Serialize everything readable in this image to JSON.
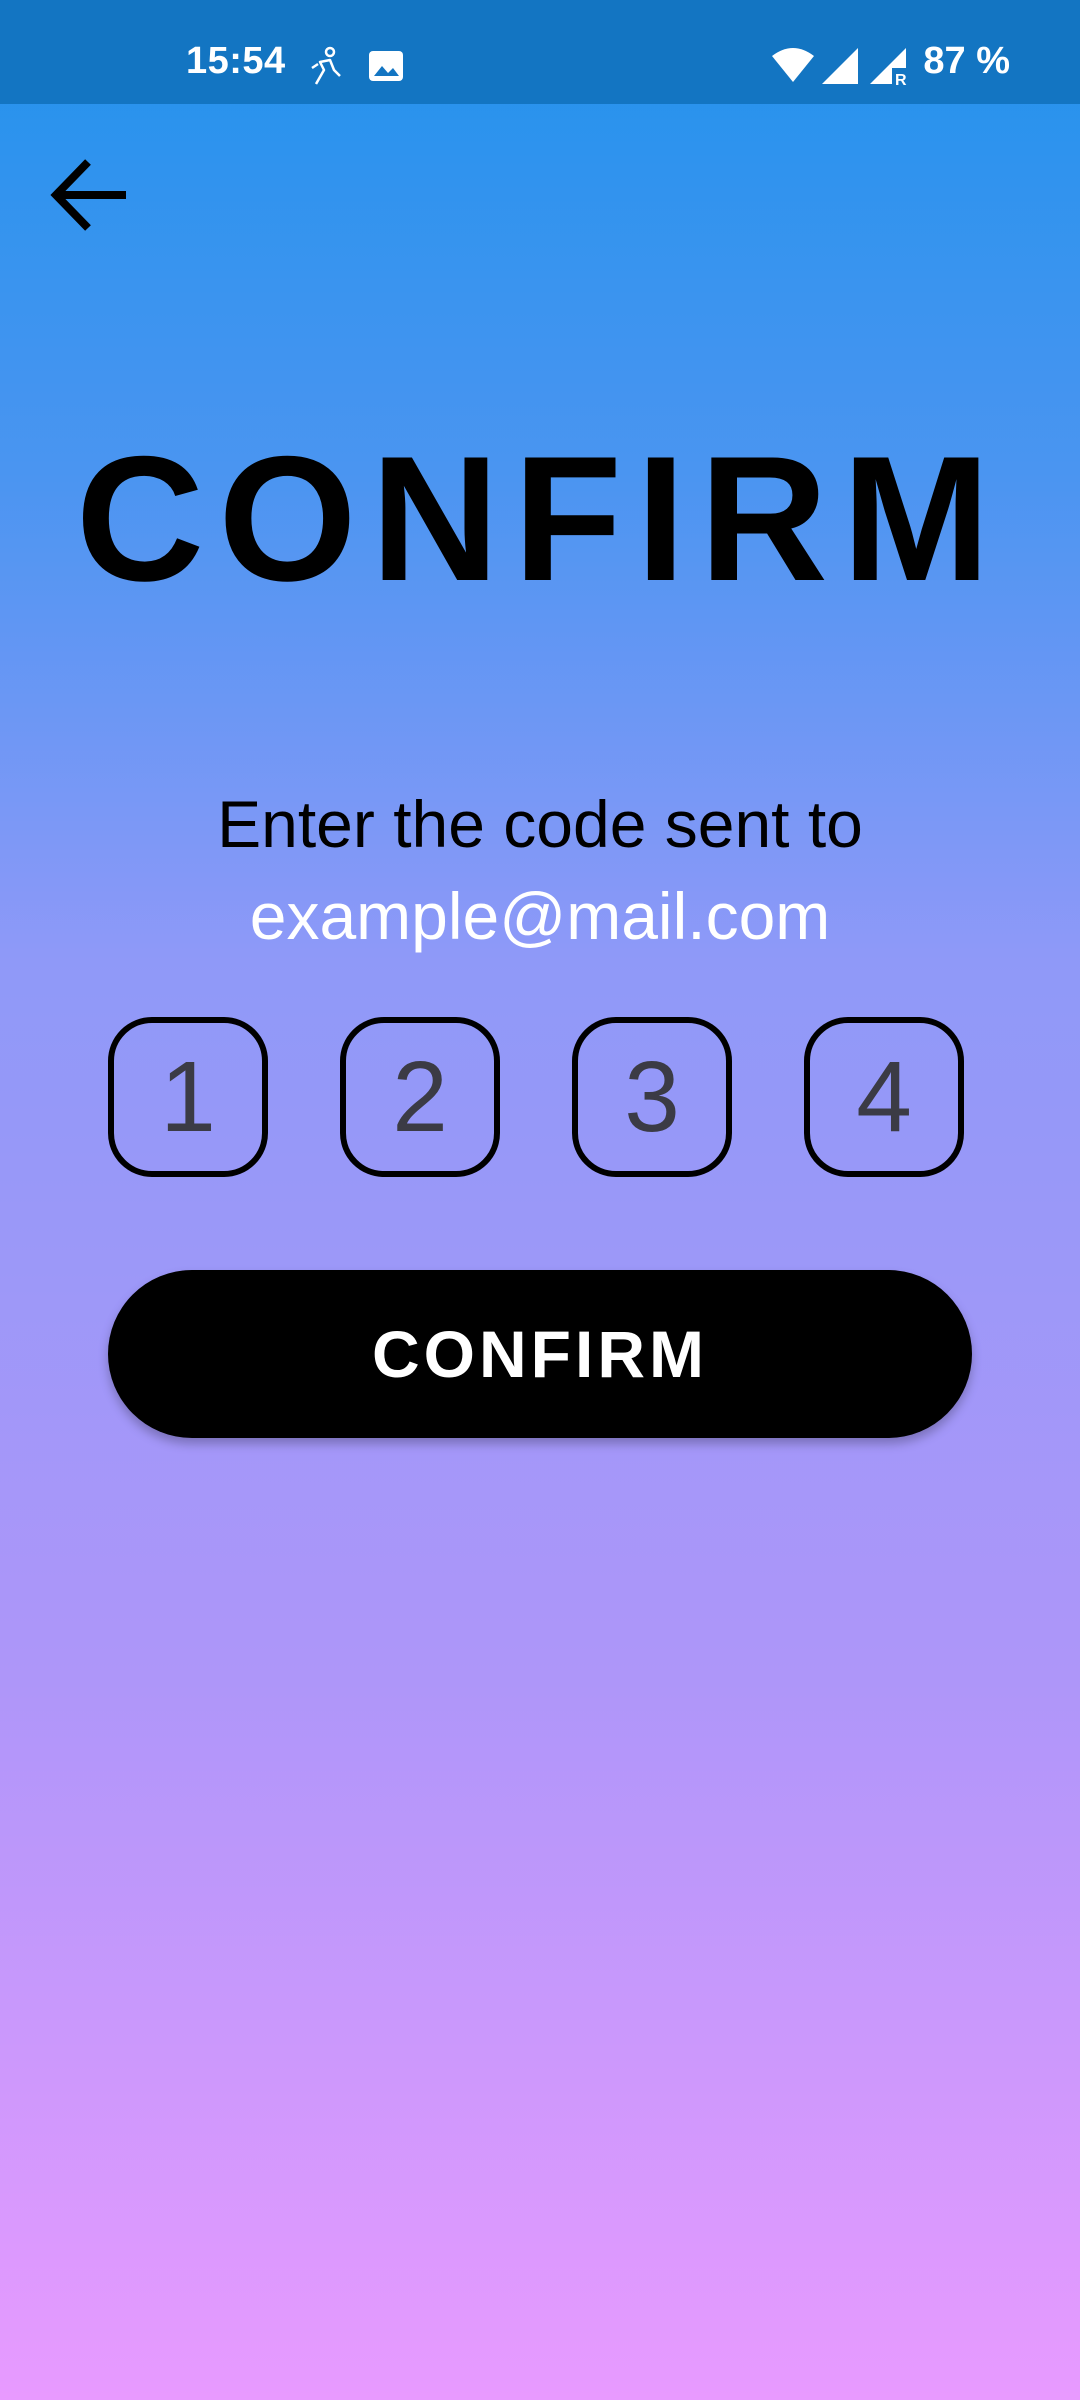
{
  "status_bar": {
    "time": "15:54",
    "battery": "87 %",
    "icons": [
      "activity-icon",
      "image-icon",
      "wifi-icon",
      "signal-icon",
      "signal-roaming-icon"
    ]
  },
  "header": {
    "back_icon": "arrow-left-icon"
  },
  "main": {
    "title": "CONFIRM",
    "instruction": "Enter the code sent to",
    "email": "example@mail.com",
    "code_digits": [
      "1",
      "2",
      "3",
      "4"
    ],
    "confirm_label": "CONFIRM"
  },
  "colors": {
    "status_bar_bg": "#1375c2",
    "gradient_top": "#2192ec",
    "gradient_bottom": "#e89aff",
    "button_bg": "#000000",
    "email_text": "#ffffff"
  }
}
